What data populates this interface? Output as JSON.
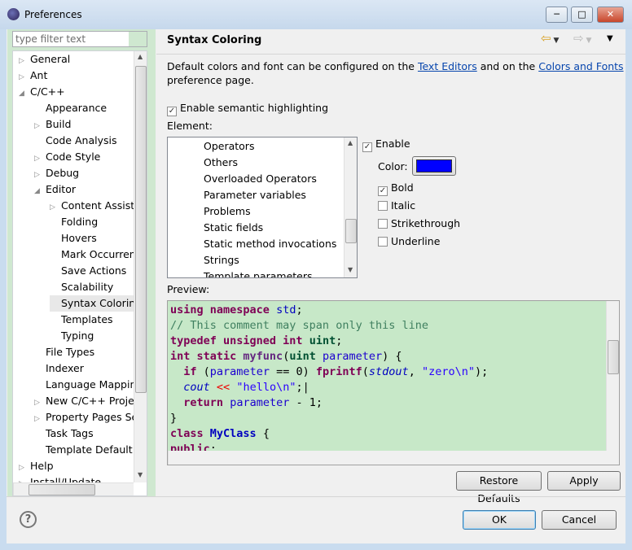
{
  "window": {
    "title": "Preferences",
    "minimize": "─",
    "maximize": "□",
    "close": "✕"
  },
  "filter": {
    "placeholder": "type filter text"
  },
  "tree": [
    {
      "label": "General",
      "level": 0,
      "arrow": "▷"
    },
    {
      "label": "Ant",
      "level": 0,
      "arrow": "▷"
    },
    {
      "label": "C/C++",
      "level": 0,
      "arrow": "◢"
    },
    {
      "label": "Appearance",
      "level": 1,
      "arrow": ""
    },
    {
      "label": "Build",
      "level": 1,
      "arrow": "▷"
    },
    {
      "label": "Code Analysis",
      "level": 1,
      "arrow": ""
    },
    {
      "label": "Code Style",
      "level": 1,
      "arrow": "▷"
    },
    {
      "label": "Debug",
      "level": 1,
      "arrow": "▷"
    },
    {
      "label": "Editor",
      "level": 1,
      "arrow": "◢"
    },
    {
      "label": "Content Assist",
      "level": 2,
      "arrow": "▷"
    },
    {
      "label": "Folding",
      "level": 2,
      "arrow": ""
    },
    {
      "label": "Hovers",
      "level": 2,
      "arrow": ""
    },
    {
      "label": "Mark Occurren",
      "level": 2,
      "arrow": ""
    },
    {
      "label": "Save Actions",
      "level": 2,
      "arrow": ""
    },
    {
      "label": "Scalability",
      "level": 2,
      "arrow": ""
    },
    {
      "label": "Syntax Coloring",
      "level": 2,
      "arrow": "",
      "selected": true
    },
    {
      "label": "Templates",
      "level": 2,
      "arrow": ""
    },
    {
      "label": "Typing",
      "level": 2,
      "arrow": ""
    },
    {
      "label": "File Types",
      "level": 1,
      "arrow": ""
    },
    {
      "label": "Indexer",
      "level": 1,
      "arrow": ""
    },
    {
      "label": "Language Mappin",
      "level": 1,
      "arrow": ""
    },
    {
      "label": "New C/C++ Projec",
      "level": 1,
      "arrow": "▷"
    },
    {
      "label": "Property Pages Se",
      "level": 1,
      "arrow": "▷"
    },
    {
      "label": "Task Tags",
      "level": 1,
      "arrow": ""
    },
    {
      "label": "Template Default V",
      "level": 1,
      "arrow": ""
    },
    {
      "label": "Help",
      "level": 0,
      "arrow": "▷"
    },
    {
      "label": "Install/Update",
      "level": 0,
      "arrow": "▷"
    }
  ],
  "page": {
    "title": "Syntax Coloring",
    "desc_pre": "Default colors and font can be configured on the ",
    "link1": "Text Editors",
    "desc_mid": " and on the ",
    "link2": "Colors and Fonts",
    "desc_post": "preference page.",
    "semantic": "Enable semantic highlighting",
    "element_label": "Element:",
    "elements": [
      "Operators",
      "Others",
      "Overloaded Operators",
      "Parameter variables",
      "Problems",
      "Static fields",
      "Static method invocations",
      "Strings",
      "Template parameters"
    ],
    "enable": "Enable",
    "color_label": "Color:",
    "color_value": "#0000ff",
    "bold": "Bold",
    "italic": "Italic",
    "strikethrough": "Strikethrough",
    "underline": "Underline",
    "preview_label": "Preview:",
    "restore": "Restore Defaults",
    "apply": "Apply"
  },
  "footer": {
    "help": "?",
    "ok": "OK",
    "cancel": "Cancel"
  }
}
